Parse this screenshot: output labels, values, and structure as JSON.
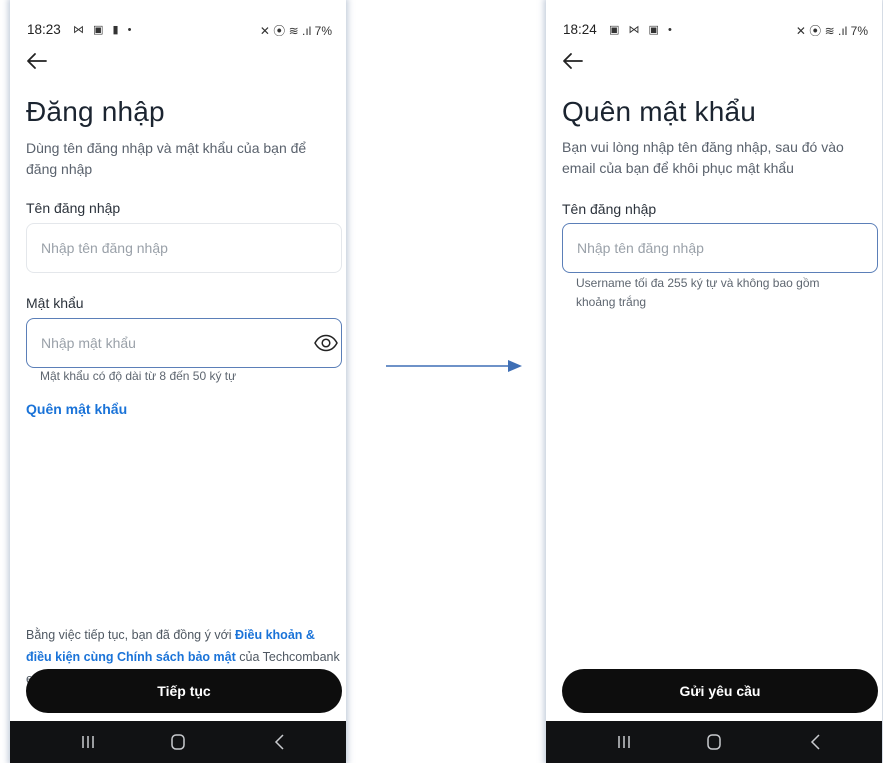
{
  "login_screen": {
    "status_bar": {
      "time": "18:23",
      "notifications": "⋈ ▣ ▮ •",
      "right": "✕ ⦿ ≋ .ıl 7%"
    },
    "back_icon": "arrow-left",
    "title": "Đăng nhập",
    "subtitle": "Dùng tên đăng nhập và mật khẩu của bạn để đăng nhập",
    "username": {
      "label": "Tên đăng nhập",
      "placeholder": "Nhập tên đăng nhập",
      "value": ""
    },
    "password": {
      "label": "Mật khẩu",
      "placeholder": "Nhập mật khẩu",
      "value": "",
      "hint": "Mật khẩu có độ dài từ 8 đến 50 ký tự",
      "toggle_icon": "eye"
    },
    "forgot_password_link": "Quên mật khẩu",
    "terms": {
      "prefix": "Bằng việc tiếp tục, bạn đã đồng ý với ",
      "link": "Điều khoản & điều kiện cùng Chính sách bảo mật",
      "suffix": "  của Techcombank ePOS."
    },
    "continue_button": "Tiếp tục"
  },
  "forgot_password_screen": {
    "status_bar": {
      "time": "18:24",
      "notifications": "▣ ⋈ ▣ •",
      "right": "✕ ⦿ ≋ .ıl 7%"
    },
    "back_icon": "arrow-left",
    "title": "Quên mật khẩu",
    "subtitle": "Bạn vui lòng nhập tên đăng nhập, sau đó vào email của bạn để khôi phục mật khẩu",
    "username": {
      "label": "Tên đăng nhập",
      "placeholder": "Nhập tên đăng nhập",
      "value": "",
      "hint": "Username tối đa 255 ký tự và không bao gồm khoảng trắng"
    },
    "send_request_button": "Gửi yêu cầu"
  },
  "colors": {
    "accent_link": "#1a73d8",
    "button_bg": "#0d0d0d",
    "focus_border": "#5b7fb8",
    "connector_arrow": "#3f6fb5"
  }
}
